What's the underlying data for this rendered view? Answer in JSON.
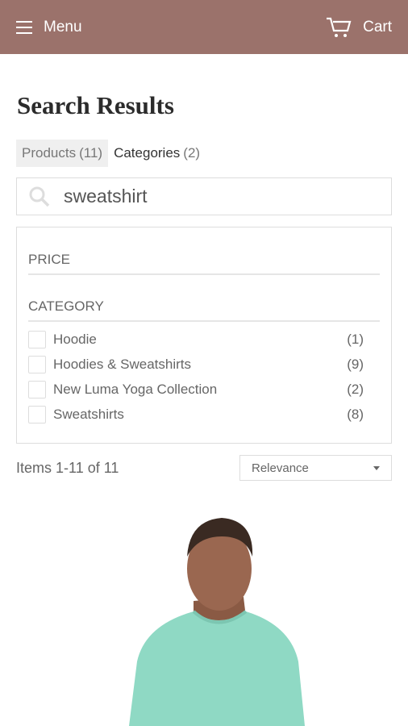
{
  "header": {
    "menu_label": "Menu",
    "cart_label": "Cart",
    "bg_color": "#9b726b"
  },
  "page_title": "Search Results",
  "tabs": [
    {
      "label": "Products",
      "count": "(11)",
      "active": true
    },
    {
      "label": "Categories",
      "count": "(2)",
      "active": false
    }
  ],
  "search": {
    "value": "sweatshirt"
  },
  "filters": {
    "price_title": "PRICE",
    "category_title": "CATEGORY",
    "options": [
      {
        "label": "Hoodie",
        "count": "(1)"
      },
      {
        "label": "Hoodies & Sweatshirts",
        "count": "(9)"
      },
      {
        "label": "New Luma Yoga Collection",
        "count": "(2)"
      },
      {
        "label": "Sweatshirts",
        "count": "(8)"
      }
    ]
  },
  "results": {
    "count_text": "Items 1-11 of 11",
    "sort_value": "Relevance"
  }
}
